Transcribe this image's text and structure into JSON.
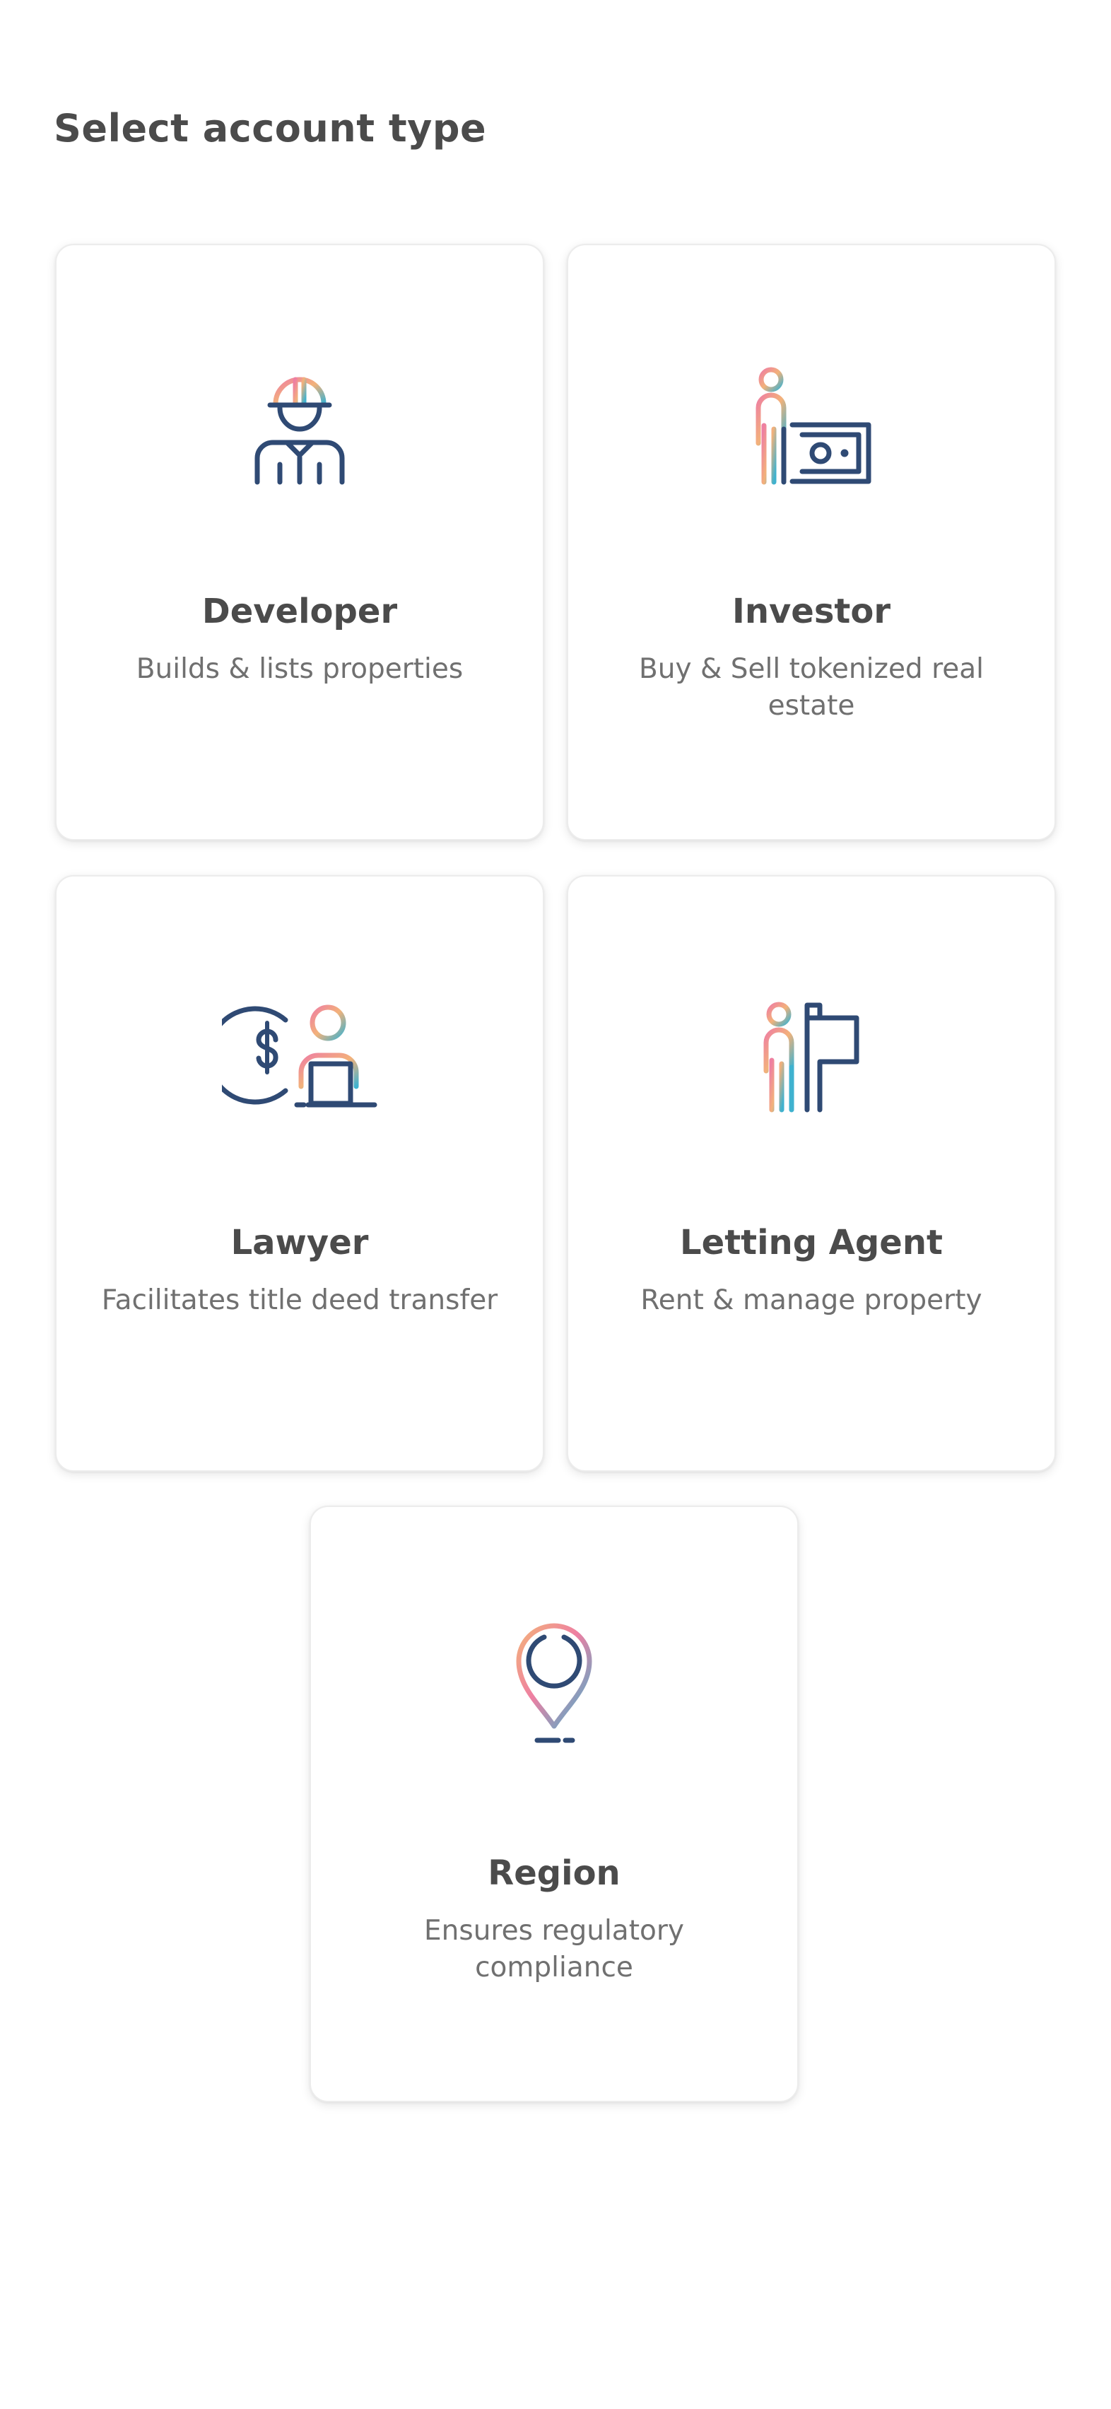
{
  "header": {
    "title": "Select account type"
  },
  "account_types": [
    {
      "icon": "developer-hardhat-icon",
      "title": "Developer",
      "description": "Builds & lists properties"
    },
    {
      "icon": "investor-money-icon",
      "title": "Investor",
      "description": "Buy & Sell tokenized real estate"
    },
    {
      "icon": "lawyer-laptop-dollar-icon",
      "title": "Lawyer",
      "description": "Facilitates title deed transfer"
    },
    {
      "icon": "letting-agent-sign-icon",
      "title": "Letting Agent",
      "description": "Rent & manage property"
    },
    {
      "icon": "region-location-pin-icon",
      "title": "Region",
      "description": "Ensures regulatory compliance"
    }
  ],
  "colors": {
    "icon_navy": "#2f4a74",
    "gradient_pink": "#ee7fa2",
    "gradient_orange": "#f3b27a",
    "gradient_teal": "#3fb2cf"
  }
}
